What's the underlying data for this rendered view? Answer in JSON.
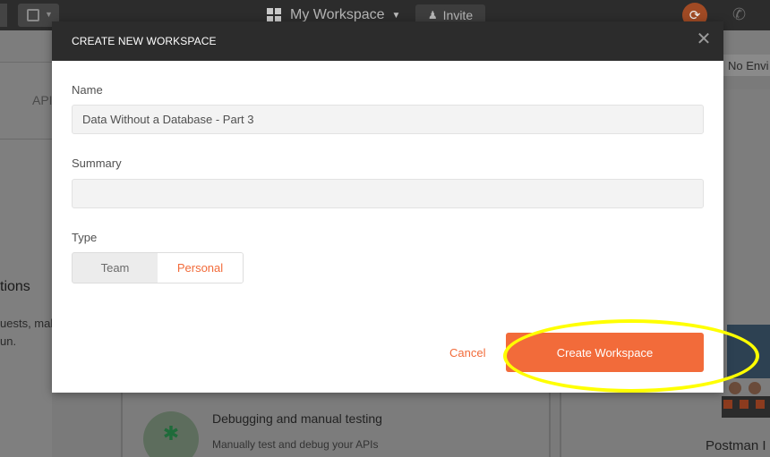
{
  "topbar": {
    "workspace_label": "My Workspace",
    "invite_label": "Invite",
    "icons": [
      "new-icon",
      "grid-icon",
      "chevron-down-icon",
      "person-icon",
      "sync-icon",
      "satellite-icon"
    ]
  },
  "background": {
    "environment_label": "No Envi",
    "apis_tab_fragment": "API",
    "section_fragment": "tions",
    "desc_fragment_1": "uests, mak",
    "desc_fragment_2": "un.",
    "card_title": "Debugging and manual testing",
    "card_subtitle": "Manually test and debug your APIs",
    "right_card_title": "Postman I"
  },
  "modal": {
    "title": "CREATE NEW WORKSPACE",
    "close_glyph": "✕",
    "name_label": "Name",
    "name_value": "Data Without a Database - Part 3",
    "summary_label": "Summary",
    "summary_value": "",
    "type_label": "Type",
    "type_options": [
      "Team",
      "Personal"
    ],
    "type_selected": "Personal",
    "cancel_label": "Cancel",
    "create_label": "Create Workspace"
  },
  "colors": {
    "accent": "#f26b3a",
    "header_bg": "#2c2c2c",
    "highlight": "#ffff00"
  }
}
